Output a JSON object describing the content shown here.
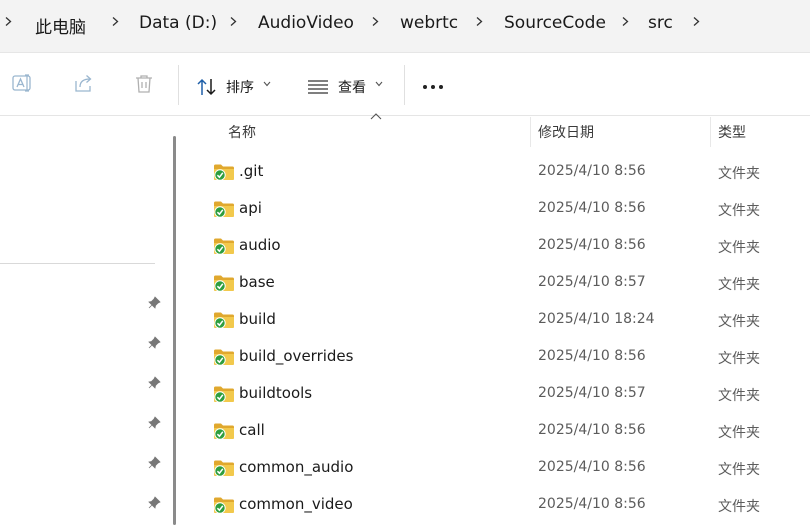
{
  "breadcrumb": [
    {
      "label": "此电脑"
    },
    {
      "label": "Data (D:)"
    },
    {
      "label": "AudioVideo"
    },
    {
      "label": "webrtc"
    },
    {
      "label": "SourceCode"
    },
    {
      "label": "src"
    }
  ],
  "toolbar": {
    "sort_label": "排序",
    "view_label": "查看",
    "icons": [
      "rename-icon",
      "share-icon",
      "delete-icon",
      "sort-icon",
      "view-icon",
      "more-icon"
    ]
  },
  "columns": {
    "name": "名称",
    "modified": "修改日期",
    "type": "类型"
  },
  "files": [
    {
      "name": ".git",
      "modified": "2025/4/10 8:56",
      "type": "文件夹"
    },
    {
      "name": "api",
      "modified": "2025/4/10 8:56",
      "type": "文件夹"
    },
    {
      "name": "audio",
      "modified": "2025/4/10 8:56",
      "type": "文件夹"
    },
    {
      "name": "base",
      "modified": "2025/4/10 8:57",
      "type": "文件夹"
    },
    {
      "name": "build",
      "modified": "2025/4/10 18:24",
      "type": "文件夹"
    },
    {
      "name": "build_overrides",
      "modified": "2025/4/10 8:56",
      "type": "文件夹"
    },
    {
      "name": "buildtools",
      "modified": "2025/4/10 8:57",
      "type": "文件夹"
    },
    {
      "name": "call",
      "modified": "2025/4/10 8:56",
      "type": "文件夹"
    },
    {
      "name": "common_audio",
      "modified": "2025/4/10 8:56",
      "type": "文件夹"
    },
    {
      "name": "common_video",
      "modified": "2025/4/10 8:56",
      "type": "文件夹"
    }
  ],
  "colors": {
    "folder": "#f2c94c",
    "folder_dark": "#e0a82e",
    "sync_badge": "#2e9e3e"
  }
}
